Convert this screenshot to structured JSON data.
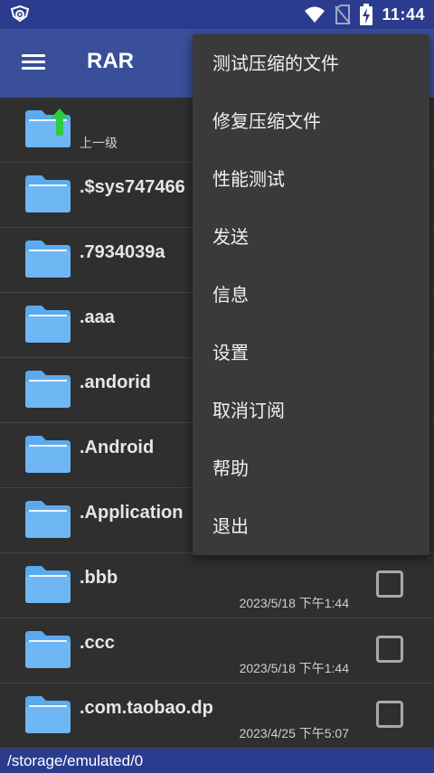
{
  "status_bar": {
    "time": "11:44",
    "icons": [
      "notification-icon",
      "wifi-icon",
      "no-sim-icon",
      "battery-charging-icon"
    ]
  },
  "toolbar": {
    "title": "RAR",
    "menu_icon": "hamburger-menu-icon"
  },
  "file_list": {
    "parent": {
      "label": "上一级",
      "icon": "folder-up-icon"
    },
    "items": [
      {
        "name": ".$sys747466",
        "date": ""
      },
      {
        "name": ".7934039a",
        "date": ""
      },
      {
        "name": ".aaa",
        "date": ""
      },
      {
        "name": ".andorid",
        "date": ""
      },
      {
        "name": ".Android",
        "date": ""
      },
      {
        "name": ".Application",
        "date": ""
      },
      {
        "name": ".bbb",
        "date": "2023/5/18 下午1:44"
      },
      {
        "name": ".ccc",
        "date": "2023/5/18 下午1:44"
      },
      {
        "name": ".com.taobao.dp",
        "date": "2023/4/25 下午5:07"
      }
    ]
  },
  "path_bar": {
    "path": "/storage/emulated/0"
  },
  "overflow_menu": {
    "items": [
      {
        "label": "测试压缩的文件"
      },
      {
        "label": "修复压缩文件"
      },
      {
        "label": "性能测试"
      },
      {
        "label": "发送"
      },
      {
        "label": "信息"
      },
      {
        "label": "设置"
      },
      {
        "label": "取消订阅"
      },
      {
        "label": "帮助"
      },
      {
        "label": "退出"
      }
    ]
  },
  "colors": {
    "status_bar": "#2b3c8f",
    "toolbar": "#3a4f9a",
    "background": "#2f2f2f",
    "folder": "#5aaaf0",
    "menu_bg": "#3a3a3a",
    "up_arrow": "#2ecc40"
  }
}
